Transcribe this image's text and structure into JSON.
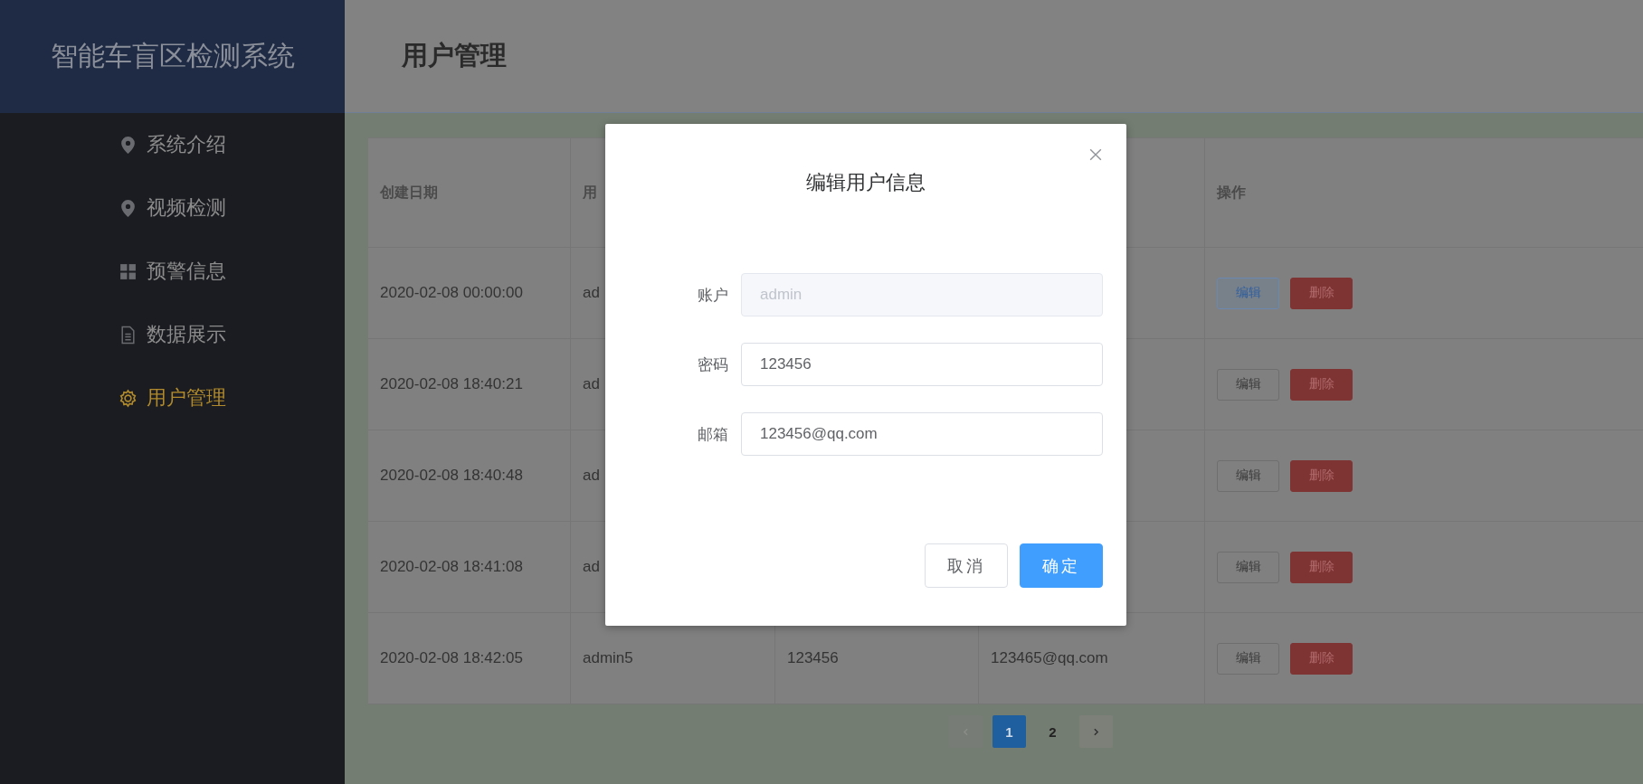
{
  "app_title": "智能车盲区检测系统",
  "sidebar": {
    "items": [
      {
        "label": "系统介绍",
        "selected": false
      },
      {
        "label": "视频检测",
        "selected": false
      },
      {
        "label": "预警信息",
        "selected": false
      },
      {
        "label": "数据展示",
        "selected": false
      },
      {
        "label": "用户管理",
        "selected": true
      }
    ]
  },
  "page_title": "用户管理",
  "table": {
    "columns": [
      {
        "label": "创建日期"
      },
      {
        "label": "用"
      },
      {},
      {},
      {
        "label": "操作"
      }
    ],
    "rows": [
      {
        "cells": [
          "2020-02-08 00:00:00",
          "ad",
          null,
          null
        ],
        "edit": {
          "label": "编辑",
          "focused": true
        },
        "delete": "删除"
      },
      {
        "cells": [
          "2020-02-08 18:40:21",
          "ad",
          null,
          null
        ],
        "edit": {
          "label": "编辑",
          "focused": false
        },
        "delete": "删除"
      },
      {
        "cells": [
          "2020-02-08 18:40:48",
          "ad",
          null,
          null
        ],
        "edit": {
          "label": "编辑",
          "focused": false
        },
        "delete": "删除"
      },
      {
        "cells": [
          "2020-02-08 18:41:08",
          "ad",
          null,
          null
        ],
        "edit": {
          "label": "编辑",
          "focused": false
        },
        "delete": "删除"
      },
      {
        "cells": [
          "2020-02-08 18:42:05",
          "admin5",
          "123456",
          "123465@qq.com"
        ],
        "edit": {
          "label": "编辑",
          "focused": false
        },
        "delete": "删除"
      }
    ]
  },
  "pagination": {
    "prev_disabled": true,
    "pages": [
      {
        "label": "1",
        "selected": true
      },
      {
        "label": "2",
        "selected": false
      }
    ],
    "next_disabled": false
  },
  "dialog": {
    "title": "编辑用户信息",
    "fields": [
      {
        "label": "账户",
        "value": "admin",
        "disabled": true
      },
      {
        "label": "密码",
        "value": "123456",
        "disabled": false
      },
      {
        "label": "邮箱",
        "value": "123456@qq.com",
        "disabled": false
      }
    ],
    "buttons": [
      {
        "label": "取消",
        "kind": "secondary"
      },
      {
        "label": "确定",
        "kind": "primary"
      }
    ]
  }
}
